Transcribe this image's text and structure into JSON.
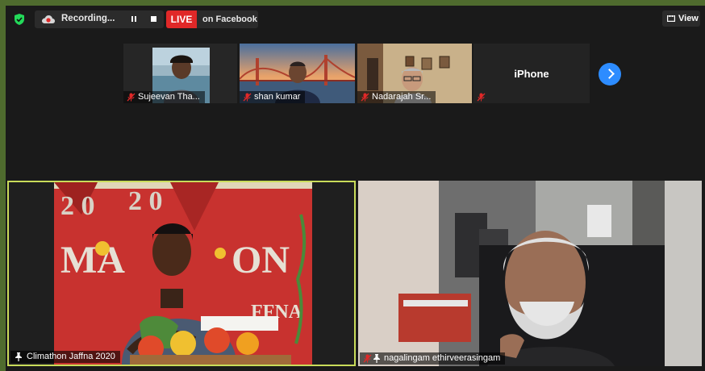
{
  "topbar": {
    "recording_label": "Recording...",
    "live_badge": "LIVE",
    "live_destination": "on Facebook",
    "view_label": "View"
  },
  "thumbnails": [
    {
      "name": "Sujeevan Tha...",
      "muted": true
    },
    {
      "name": "shan kumar",
      "muted": true
    },
    {
      "name": "Nadarajah Sr...",
      "muted": true
    },
    {
      "name": "iPhone",
      "muted": true
    }
  ],
  "gallery": {
    "left_tile": {
      "name": "Climathon Jaffna 2020",
      "pinned": true,
      "muted": false
    },
    "right_tile": {
      "name": "nagalingam ethirveerasingam",
      "pinned": true,
      "muted": true
    }
  },
  "colors": {
    "active_speaker_border": "#c9dc5a",
    "live_red": "#e02828",
    "accent_blue": "#2d8cff",
    "encryption_green": "#23d959"
  },
  "icons": [
    "shield-icon",
    "cloud-record-icon",
    "pause-icon",
    "stop-icon",
    "view-grid-icon",
    "mic-off-icon",
    "pin-icon",
    "chevron-right-icon"
  ]
}
